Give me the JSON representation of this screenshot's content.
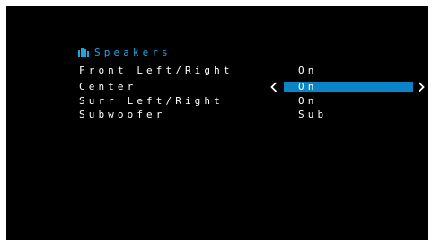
{
  "colors": {
    "background": "#000000",
    "text": "#ffffff",
    "title": "#1ba6e0",
    "selection": "#0a84c6"
  },
  "menu": {
    "icon": "speaker-icon",
    "title": "Speakers",
    "selected_index": 1,
    "rows": [
      {
        "label": "Front Left/Right",
        "value": "On"
      },
      {
        "label": "Center",
        "value": "On"
      },
      {
        "label": "Surr Left/Right",
        "value": "On"
      },
      {
        "label": "Subwoofer",
        "value": "Sub"
      }
    ]
  }
}
